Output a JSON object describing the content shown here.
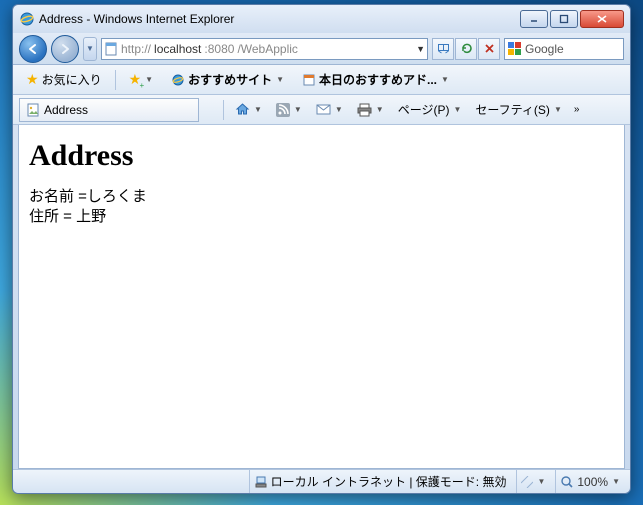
{
  "window": {
    "title": "Address - Windows Internet Explorer"
  },
  "nav": {
    "url_prefix": "http://",
    "url_host": "localhost",
    "url_port": ":8080",
    "url_path": "/WebApplic",
    "search_engine": "Google"
  },
  "favbar": {
    "favorites": "お気に入り",
    "suggested_sites": "おすすめサイト",
    "addons": "本日のおすすめアド..."
  },
  "tab": {
    "title": "Address"
  },
  "cmdbar": {
    "page": "ページ(P)",
    "safety": "セーフティ(S)"
  },
  "page": {
    "heading": "Address",
    "line1": "お名前 =しろくま",
    "line2": "住所 = 上野"
  },
  "status": {
    "zone": "ローカル イントラネット | 保護モード: 無効",
    "zoom": "100%"
  }
}
